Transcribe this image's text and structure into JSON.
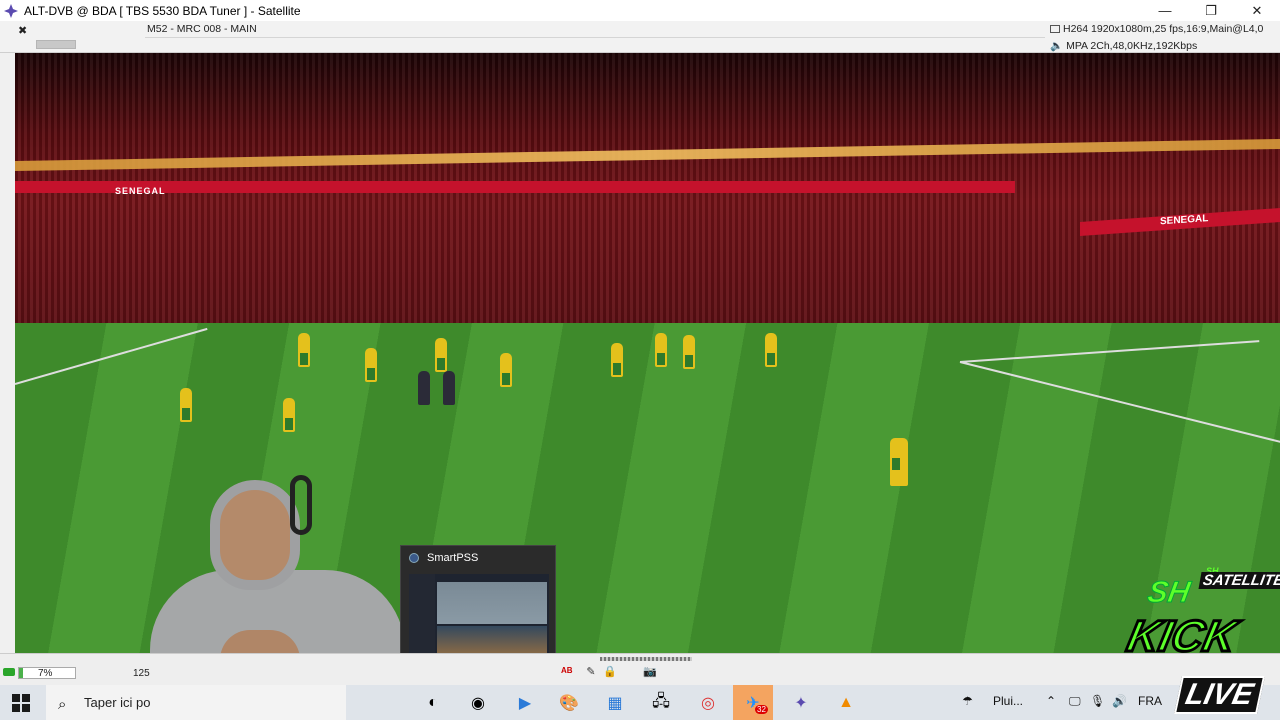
{
  "window": {
    "title": "ALT-DVB @ BDA [ TBS 5530 BDA Tuner ] - Satellite",
    "minimize": "—",
    "restore": "❐",
    "close": "✕"
  },
  "infobar": {
    "close": "✖",
    "channel": "M52 - MRC 008 - MAIN",
    "video_info": "H264 1920x1080m,25 fps,16:9,Main@L4,0",
    "audio_info": "MPA 2Ch,48,0KHz,192Kbps"
  },
  "video": {
    "banner_text": "SENEGAL",
    "banner_text_right": "SENEGAL"
  },
  "popup": {
    "title": "SmartPSS"
  },
  "controlbar": {
    "progress_percent": 7,
    "progress_label": "7%",
    "counter": "125",
    "ab": "AB"
  },
  "taskbar": {
    "search_placeholder": "Taper ici po",
    "weather": "Plui...",
    "language": "FRA",
    "badge_count": "32"
  },
  "overlay_logo": {
    "top_small": "SH",
    "top": "SATELLITE",
    "main": "KICK",
    "bottom": "LIVE",
    "letters": "SH"
  },
  "colors": {
    "accent_green": "#5dff2a",
    "banner_red": "#c5122c"
  }
}
